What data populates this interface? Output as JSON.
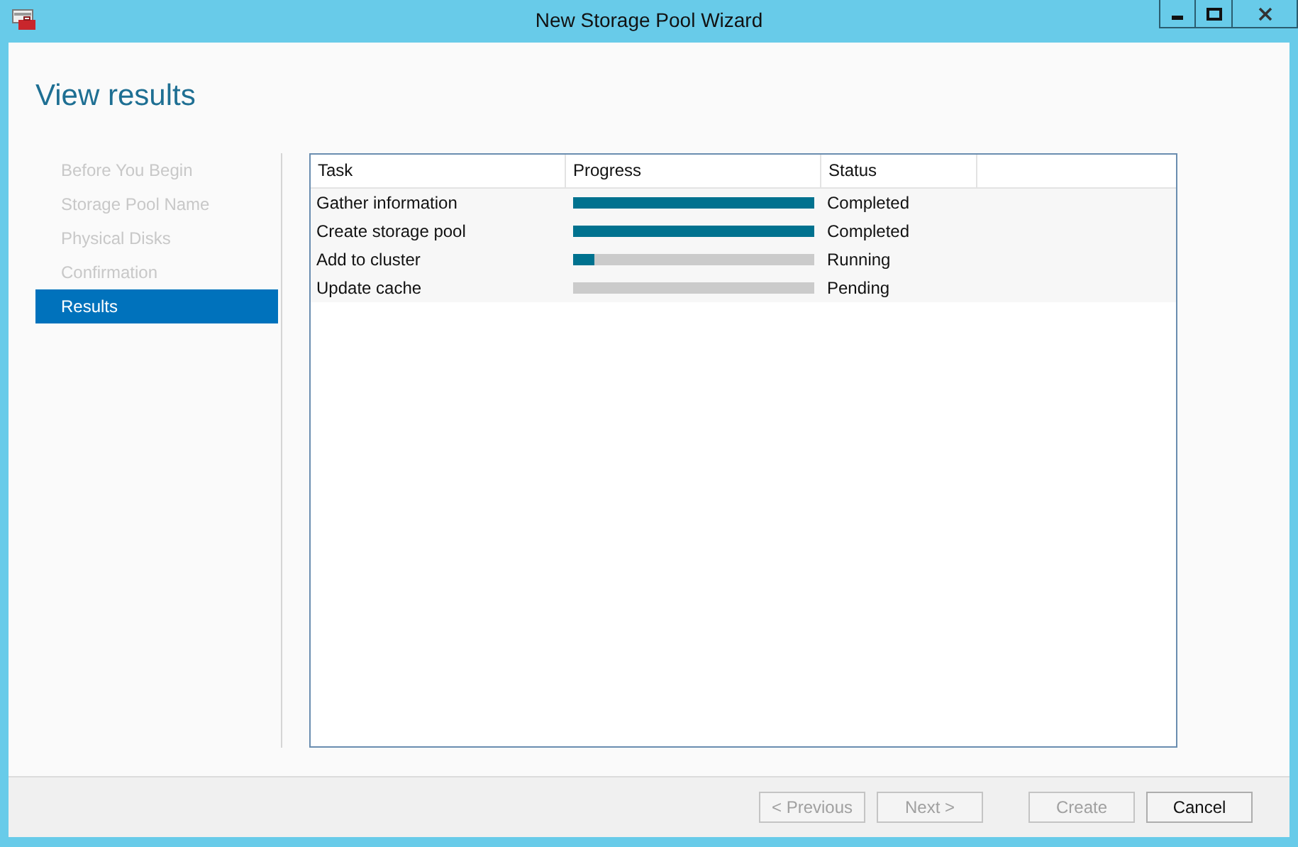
{
  "window": {
    "title": "New Storage Pool Wizard"
  },
  "heading": "View results",
  "steps": [
    {
      "label": "Before You Begin",
      "selected": false
    },
    {
      "label": "Storage Pool Name",
      "selected": false
    },
    {
      "label": "Physical Disks",
      "selected": false
    },
    {
      "label": "Confirmation",
      "selected": false
    },
    {
      "label": "Results",
      "selected": true
    }
  ],
  "table": {
    "columns": [
      "Task",
      "Progress",
      "Status"
    ],
    "rows": [
      {
        "task": "Gather information",
        "level": 1,
        "status": "Completed"
      },
      {
        "task": "Create storage pool",
        "level": 1,
        "status": "Completed"
      },
      {
        "task": "Add to cluster",
        "level": 0.09,
        "status": "Running"
      },
      {
        "task": "Update cache",
        "level": 0,
        "status": "Pending"
      }
    ]
  },
  "buttons": [
    {
      "label": "< Previous",
      "disabled": true
    },
    {
      "label": "Next >",
      "disabled": true
    },
    {
      "label": "Create",
      "disabled": true
    },
    {
      "label": "Cancel",
      "disabled": false
    }
  ]
}
